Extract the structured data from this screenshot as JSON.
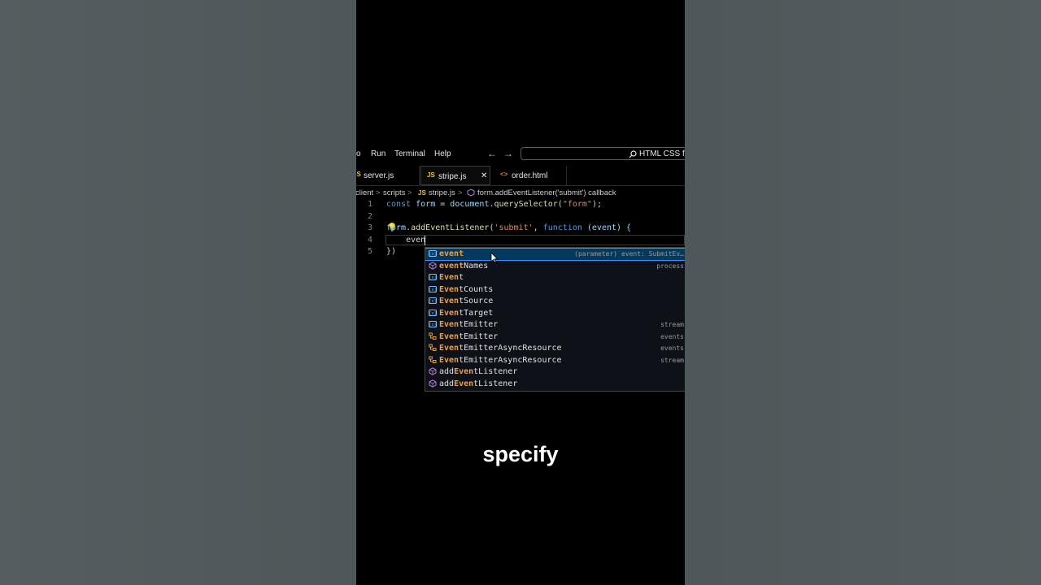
{
  "menu": {
    "items": [
      "o",
      "Run",
      "Terminal",
      "Help"
    ]
  },
  "search": {
    "label": "HTML CSS fro"
  },
  "tabs": [
    {
      "icon": "JS",
      "label": "server.js",
      "icon_color": "#e8c547"
    },
    {
      "icon": "JS",
      "label": "stripe.js",
      "icon_color": "#e8c547",
      "close": "✕"
    },
    {
      "icon": "<>",
      "label": "order.html",
      "icon_color": "#e37933"
    }
  ],
  "breadcrumb": {
    "segments": [
      "client",
      "scripts",
      "stripe.js",
      "form.addEventListener('submit') callback"
    ],
    "file_icon": "JS",
    "separator": ">"
  },
  "code": {
    "line_numbers": [
      "1",
      "2",
      "3",
      "4",
      "5"
    ],
    "line1": {
      "kw": "const",
      "var": "form",
      "eq": " = ",
      "obj": "document",
      "dot": ".",
      "fn": "querySelector",
      "open": "(",
      "str": "\"form\"",
      "close": ");"
    },
    "line3": {
      "obj": "form",
      "dot": ".",
      "fn": "addEventListener",
      "open": "(",
      "str": "'submit'",
      "comma": ", ",
      "kw": "function",
      "params": " (event) {"
    },
    "line4": {
      "text": "    even"
    },
    "line5": {
      "text": "})"
    }
  },
  "suggestions": [
    {
      "pre": "",
      "hl": "event",
      "post": "",
      "detail": "(parameter) event: SubmitEv…",
      "kind": "variable",
      "selected": true
    },
    {
      "pre": "",
      "hl": "event",
      "post": "Names",
      "detail": "process",
      "kind": "method"
    },
    {
      "pre": "",
      "hl": "Even",
      "post": "t",
      "detail": "",
      "kind": "variable"
    },
    {
      "pre": "",
      "hl": "Even",
      "post": "tCounts",
      "detail": "",
      "kind": "variable"
    },
    {
      "pre": "",
      "hl": "Even",
      "post": "tSource",
      "detail": "",
      "kind": "variable"
    },
    {
      "pre": "",
      "hl": "Even",
      "post": "tTarget",
      "detail": "",
      "kind": "variable"
    },
    {
      "pre": "",
      "hl": "Even",
      "post": "tEmitter",
      "detail": "stream",
      "kind": "variable"
    },
    {
      "pre": "",
      "hl": "Even",
      "post": "tEmitter",
      "detail": "events",
      "kind": "class"
    },
    {
      "pre": "",
      "hl": "Even",
      "post": "tEmitterAsyncResource",
      "detail": "events",
      "kind": "class"
    },
    {
      "pre": "",
      "hl": "Even",
      "post": "tEmitterAsyncResource",
      "detail": "stream",
      "kind": "class"
    },
    {
      "pre": "add",
      "hl": "Even",
      "post": "tListener",
      "detail": "",
      "kind": "method"
    },
    {
      "pre": "add",
      "hl": "Even",
      "post": "tListener",
      "detail": "",
      "kind": "method"
    }
  ],
  "caption": "specify"
}
